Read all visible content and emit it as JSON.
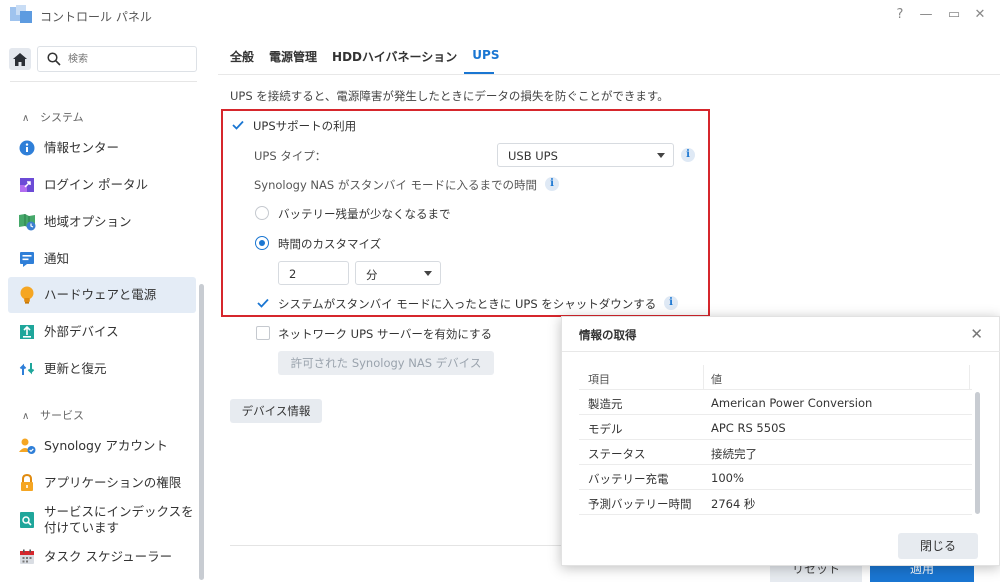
{
  "window": {
    "title": "コントロール パネル",
    "controls": {
      "help": "?",
      "minimize": "—",
      "maximize": "▭",
      "close": "✕"
    }
  },
  "sidebar": {
    "search_placeholder": "検索",
    "sections": [
      {
        "label": "システム"
      },
      {
        "label": "サービス"
      }
    ],
    "items": [
      {
        "label": "情報センター",
        "icon": "info-circle-icon"
      },
      {
        "label": "ログイン ポータル",
        "icon": "login-portal-icon"
      },
      {
        "label": "地域オプション",
        "icon": "regional-options-icon"
      },
      {
        "label": "通知",
        "icon": "notification-icon"
      },
      {
        "label": "ハードウェアと電源",
        "icon": "lightbulb-icon",
        "active": true
      },
      {
        "label": "外部デバイス",
        "icon": "external-device-icon"
      },
      {
        "label": "更新と復元",
        "icon": "update-restore-icon"
      },
      {
        "label": "Synology アカウント",
        "icon": "synology-account-icon"
      },
      {
        "label": "アプリケーションの権限",
        "icon": "lock-icon"
      },
      {
        "label": "サービスにインデックスを付けています",
        "icon": "indexing-service-icon"
      },
      {
        "label": "タスク スケジューラー",
        "icon": "calendar-icon"
      }
    ]
  },
  "tabs": [
    {
      "label": "全般"
    },
    {
      "label": "電源管理"
    },
    {
      "label": "HDDハイバネーション"
    },
    {
      "label": "UPS",
      "active": true
    }
  ],
  "ups": {
    "description": "UPS を接続すると、電源障害が発生したときにデータの損失を防ぐことができます。",
    "enable_label": "UPSサポートの利用",
    "type_label": "UPS タイプ：",
    "type_value": "USB UPS",
    "standby_label": "Synology NAS がスタンバイ モードに入るまでの時間",
    "radio_low_battery": "バッテリー残量が少なくなるまで",
    "radio_custom": "時間のカスタマイズ",
    "time_value": "2",
    "time_unit": "分",
    "shutdown_label": "システムがスタンバイ モードに入ったときに UPS をシャットダウンする",
    "network_server_label": "ネットワーク UPS サーバーを有効にする",
    "allowed_devices_button": "許可された Synology NAS デバイス",
    "device_info_button": "デバイス情報"
  },
  "footer": {
    "reset_button": "リセット",
    "apply_button": "適用"
  },
  "dialog": {
    "title": "情報の取得",
    "close_icon": "✕",
    "headers": {
      "key": "項目",
      "value": "値"
    },
    "rows": [
      {
        "key": "製造元",
        "value": "American Power Conversion"
      },
      {
        "key": "モデル",
        "value": "APC RS 550S"
      },
      {
        "key": "ステータス",
        "value": "接続完了"
      },
      {
        "key": "バッテリー充電",
        "value": "100%"
      },
      {
        "key": "予測バッテリー時間",
        "value": "2764 秒"
      }
    ],
    "close_button": "閉じる"
  },
  "colors": {
    "accent": "#1a76d2",
    "highlight_box": "#d6262c",
    "active_sidebar": "#e4ecf6"
  }
}
